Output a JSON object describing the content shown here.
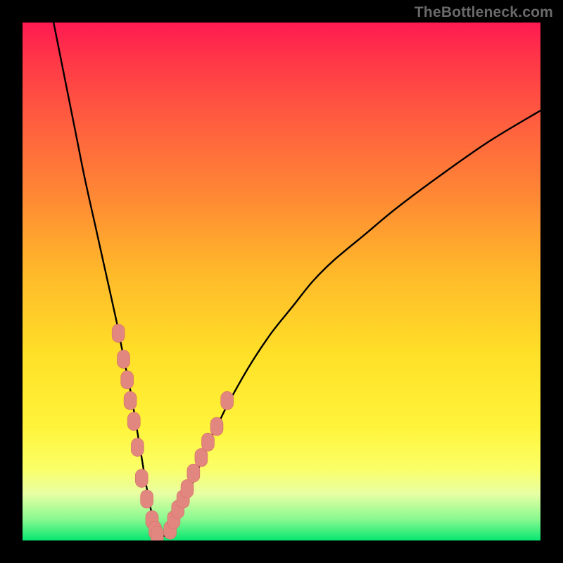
{
  "watermark": "TheBottleneck.com",
  "colors": {
    "curve": "#000000",
    "marker_fill": "#e2877f",
    "marker_stroke": "#d56e66",
    "gradient_top": "#ff1a52",
    "gradient_bottom": "#06e670"
  },
  "chart_data": {
    "type": "line",
    "title": "",
    "xlabel": "",
    "ylabel": "",
    "xlim": [
      0,
      100
    ],
    "ylim": [
      0,
      100
    ],
    "curve": {
      "x": [
        6,
        8,
        10,
        12,
        14,
        16,
        18,
        19,
        20,
        21,
        22,
        23,
        24,
        25,
        26,
        27,
        28,
        29,
        30,
        32,
        34,
        36,
        38,
        40,
        44,
        48,
        52,
        56,
        60,
        66,
        72,
        80,
        90,
        100
      ],
      "y": [
        100,
        90,
        80,
        70,
        61,
        52,
        43,
        38,
        33,
        28,
        22,
        16,
        10,
        5,
        2,
        1,
        1,
        2,
        4,
        9,
        14,
        19,
        23,
        27,
        34,
        40,
        45,
        50,
        54,
        59,
        64,
        70,
        77,
        83
      ]
    },
    "markers_left": {
      "x": [
        18.5,
        19.5,
        20.2,
        20.8,
        21.5,
        22.2,
        23.0,
        24.0,
        25.0,
        25.6,
        26.0
      ],
      "y": [
        40,
        35,
        31,
        27,
        23,
        18,
        12,
        8,
        4,
        2,
        1
      ]
    },
    "markers_right": {
      "x": [
        28.5,
        29.2,
        30.0,
        31.0,
        31.8,
        33.0,
        34.5,
        35.8,
        37.5,
        39.5
      ],
      "y": [
        2,
        4,
        6,
        8,
        10,
        13,
        16,
        19,
        22,
        27
      ]
    }
  }
}
